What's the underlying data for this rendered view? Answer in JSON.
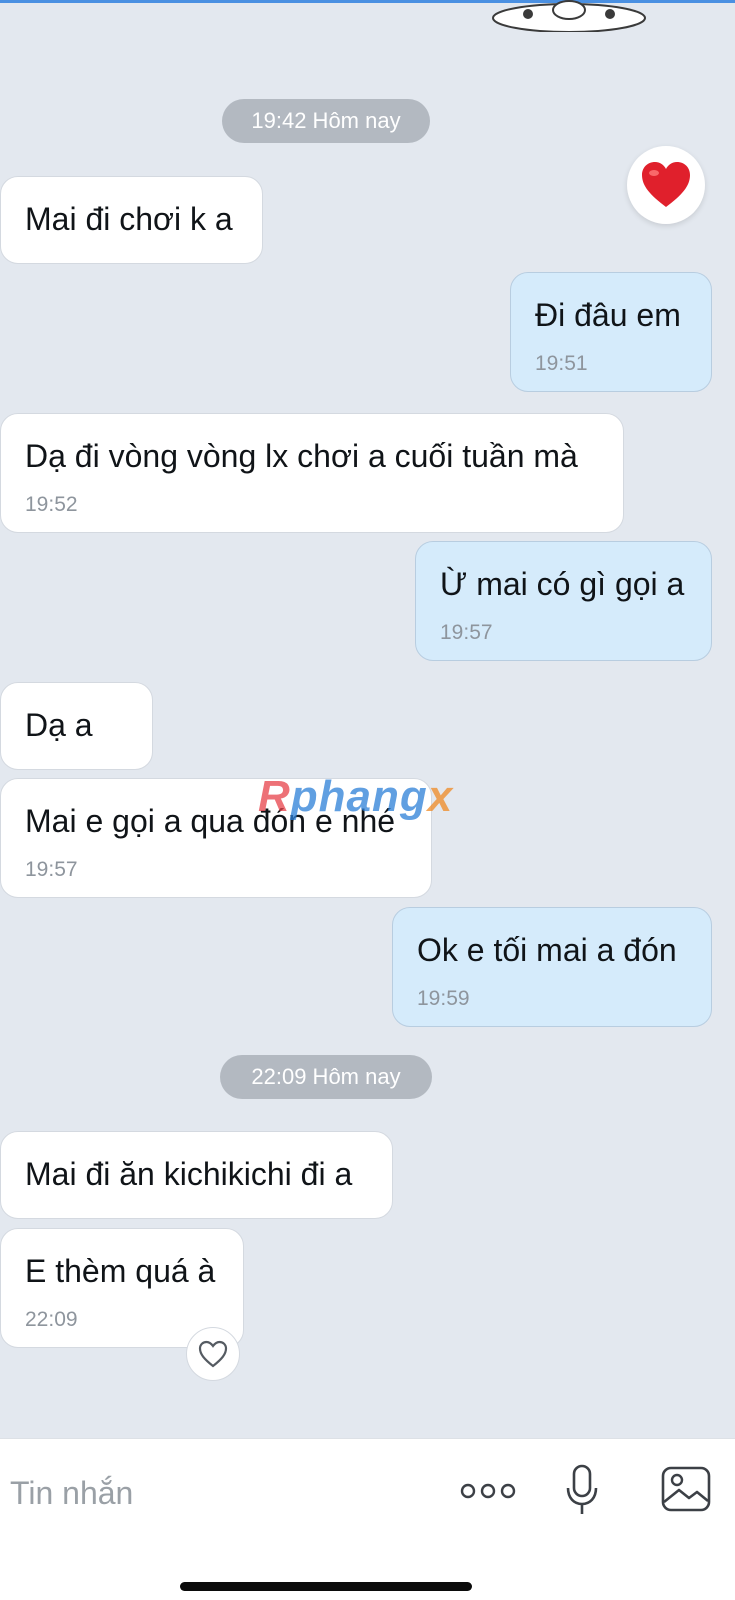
{
  "chat": {
    "separators": [
      {
        "label": "19:42 Hôm nay"
      },
      {
        "label": "22:09 Hôm nay"
      }
    ],
    "messages": [
      {
        "dir": "in",
        "text": "Mai đi chơi k a",
        "time": ""
      },
      {
        "dir": "out",
        "text": "Đi đâu em",
        "time": "19:51"
      },
      {
        "dir": "in",
        "text": "Dạ đi vòng vòng lx chơi a cuối tuần mà",
        "time": "19:52"
      },
      {
        "dir": "out",
        "text": "Ừ mai có gì gọi a",
        "time": "19:57"
      },
      {
        "dir": "in",
        "text": "Dạ a",
        "time": ""
      },
      {
        "dir": "in",
        "text": "Mai e gọi a qua đón e nhé",
        "time": "19:57"
      },
      {
        "dir": "out",
        "text": "Ok e tối mai a đón",
        "time": "19:59"
      },
      {
        "dir": "in",
        "text": "Mai đi ăn kichikichi đi a",
        "time": ""
      },
      {
        "dir": "in",
        "text": "E thèm quá à",
        "time": "22:09"
      }
    ],
    "reaction_icon": "heart-reaction-icon",
    "like_icon": "heart-outline-icon"
  },
  "watermark": {
    "part1": "R",
    "part2": "phang",
    "part3": "x"
  },
  "composer": {
    "placeholder": "Tin nhắn",
    "icons": [
      "more-icon",
      "microphone-icon",
      "image-icon"
    ]
  },
  "colors": {
    "background": "#e3e8ef",
    "incoming_bubble": "#ffffff",
    "outgoing_bubble": "#d5ebfb",
    "time_pill": "#b3b9c1",
    "heart": "#e0202c"
  }
}
